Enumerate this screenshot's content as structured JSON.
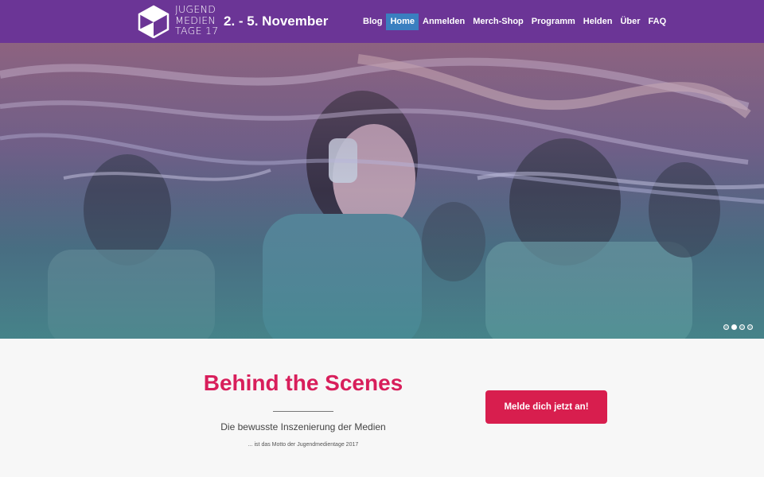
{
  "header": {
    "logo_lines": [
      "JUGEND",
      "MEDIEN",
      "TAGE 17"
    ],
    "date": "2. - 5. November",
    "nav": [
      {
        "label": "Blog",
        "active": false
      },
      {
        "label": "Home",
        "active": true
      },
      {
        "label": "Anmelden",
        "active": false
      },
      {
        "label": "Merch-Shop",
        "active": false
      },
      {
        "label": "Programm",
        "active": false
      },
      {
        "label": "Helden",
        "active": false
      },
      {
        "label": "Über",
        "active": false
      },
      {
        "label": "FAQ",
        "active": false
      }
    ]
  },
  "slider": {
    "slide_count": 4,
    "active_slide": 2
  },
  "main": {
    "headline": "Behind the Scenes",
    "subtitle": "Die bewusste Inszenierung der Medien",
    "motto": "... ist das Motto der Jugendmedientage 2017",
    "cta_label": "Melde dich jetzt an!"
  },
  "colors": {
    "topbar": "#6b3596",
    "active_nav": "#3a7fc0",
    "accent": "#d81e5b",
    "cta": "#d81e4e"
  }
}
